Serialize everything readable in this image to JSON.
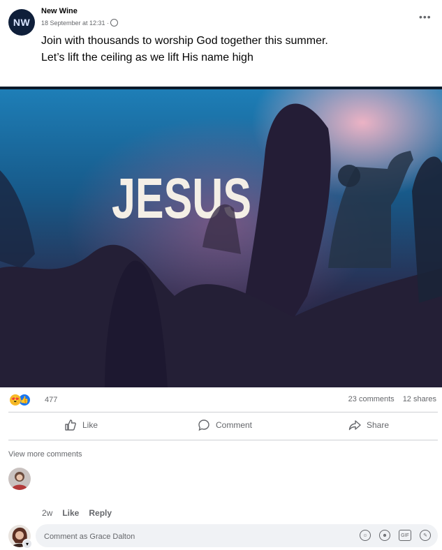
{
  "post": {
    "avatar_initials": "NW",
    "page_name": "New Wine",
    "timestamp": "18 September at 12:31 ·",
    "text_line1": "Join with thousands to worship God together this summer.",
    "text_line2": "Let’s lift the ceiling as we lift His name high",
    "image_text": "JESUS"
  },
  "stats": {
    "reaction_count": "477",
    "comments": "23 comments",
    "shares": "12 shares"
  },
  "actions": {
    "like": "Like",
    "comment": "Comment",
    "share": "Share"
  },
  "comments": {
    "view_more": "View more comments",
    "age": "2w",
    "like": "Like",
    "reply": "Reply",
    "input_placeholder": "Comment as Grace Dalton"
  },
  "colors": {
    "accent": "#1877f2",
    "secondary_text": "#65676b",
    "comment_box_bg": "#f0f2f5"
  },
  "icons": [
    "globe-icon",
    "more-icon",
    "like-icon",
    "comment-icon",
    "share-icon",
    "sticker-icon",
    "emoji-icon",
    "gif-icon",
    "attach-sticker-icon"
  ]
}
